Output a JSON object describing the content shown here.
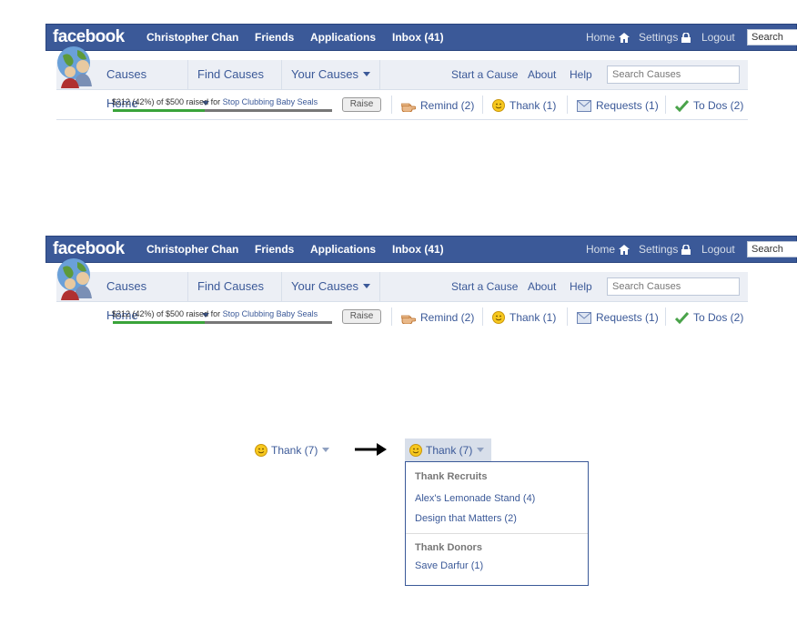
{
  "topbars": [
    {
      "logo": "facebook",
      "nav": [
        "Christopher Chan",
        "Friends",
        "Applications",
        "Inbox (41)"
      ],
      "right_nav": {
        "home": "Home",
        "settings": "Settings",
        "logout": "Logout"
      },
      "search_value": "Search"
    }
  ],
  "causes": {
    "tabs": [
      {
        "label": "Causes Home",
        "has_dropdown": false
      },
      {
        "label": "Find Causes",
        "has_dropdown": true
      },
      {
        "label": "Your Causes",
        "has_dropdown": true
      }
    ],
    "links": [
      "Start a Cause",
      "About",
      "Help"
    ],
    "search_placeholder": "Search Causes",
    "raised": {
      "text": "$212 (42%) of $500 raised for",
      "cause": "Stop Clubbing Baby Seals",
      "progress": 0.42,
      "button": "Raise"
    },
    "actions": {
      "remind": "Remind (2)",
      "thank": "Thank (1)",
      "requests": "Requests (1)",
      "todos": "To Dos (2)"
    }
  },
  "demo": {
    "thank_label": "Thank (7)",
    "dropdown": {
      "recruits_heading": "Thank Recruits",
      "recruits": [
        "Alex's Lemonade Stand (4)",
        "Design that Matters (2)"
      ],
      "donors_heading": "Thank Donors",
      "donors": [
        "Save Darfur (1)"
      ]
    }
  },
  "colors": {
    "fb_blue": "#3b5998",
    "link": "#3b5998",
    "progress": "#3aa33a"
  }
}
